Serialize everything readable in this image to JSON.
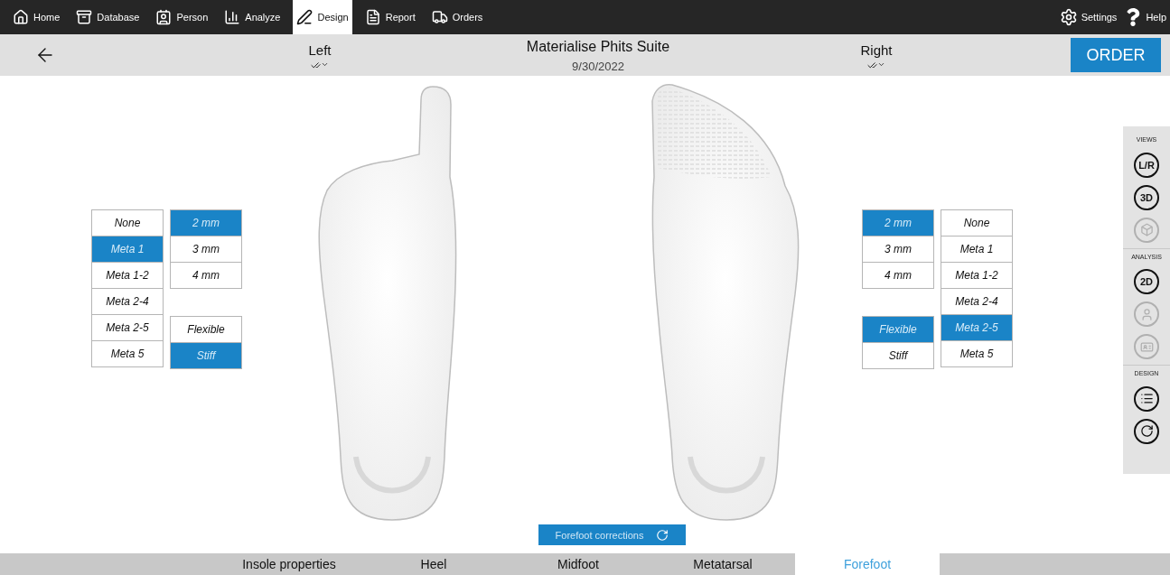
{
  "nav": {
    "items": [
      {
        "kind": "home",
        "label": "Home",
        "selected": false
      },
      {
        "kind": "database",
        "label": "Database",
        "selected": false
      },
      {
        "kind": "person",
        "label": "Person",
        "selected": false
      },
      {
        "kind": "analyze",
        "label": "Analyze",
        "selected": false
      },
      {
        "kind": "design",
        "label": "Design",
        "selected": true
      },
      {
        "kind": "report",
        "label": "Report",
        "selected": false
      },
      {
        "kind": "orders",
        "label": "Orders",
        "selected": false
      }
    ],
    "right": [
      {
        "kind": "settings",
        "label": "Settings"
      },
      {
        "kind": "help",
        "label": "Help"
      }
    ]
  },
  "header": {
    "left_label": "Left",
    "title": "Materialise Phits Suite",
    "date": "9/30/2022",
    "right_label": "Right",
    "order_button": "ORDER"
  },
  "left_options": {
    "meta": [
      {
        "label": "None",
        "selected": false
      },
      {
        "label": "Meta 1",
        "selected": true
      },
      {
        "label": "Meta 1-2",
        "selected": false
      },
      {
        "label": "Meta 2-4",
        "selected": false
      },
      {
        "label": "Meta 2-5",
        "selected": false
      },
      {
        "label": "Meta 5",
        "selected": false
      }
    ],
    "thickness": [
      {
        "label": "2 mm",
        "selected": true
      },
      {
        "label": "3 mm",
        "selected": false
      },
      {
        "label": "4 mm",
        "selected": false
      }
    ],
    "stiffness": [
      {
        "label": "Flexible",
        "selected": false
      },
      {
        "label": "Stiff",
        "selected": true
      }
    ]
  },
  "right_options": {
    "meta": [
      {
        "label": "None",
        "selected": false
      },
      {
        "label": "Meta 1",
        "selected": false
      },
      {
        "label": "Meta 1-2",
        "selected": false
      },
      {
        "label": "Meta 2-4",
        "selected": false
      },
      {
        "label": "Meta 2-5",
        "selected": true
      },
      {
        "label": "Meta 5",
        "selected": false
      }
    ],
    "thickness": [
      {
        "label": "2 mm",
        "selected": true
      },
      {
        "label": "3 mm",
        "selected": false
      },
      {
        "label": "4 mm",
        "selected": false
      }
    ],
    "stiffness": [
      {
        "label": "Flexible",
        "selected": true
      },
      {
        "label": "Stiff",
        "selected": false
      }
    ]
  },
  "side_panel": [
    {
      "title": "VIEWS",
      "buttons": [
        {
          "kind": "text",
          "label": "L/R",
          "disabled": false
        },
        {
          "kind": "text",
          "label": "3D",
          "disabled": false
        },
        {
          "kind": "cube",
          "disabled": true
        }
      ]
    },
    {
      "title": "ANALYSIS",
      "buttons": [
        {
          "kind": "text",
          "label": "2D",
          "disabled": false
        },
        {
          "kind": "person",
          "disabled": true
        },
        {
          "kind": "card",
          "disabled": true
        }
      ]
    },
    {
      "title": "DESIGN",
      "buttons": [
        {
          "kind": "list",
          "disabled": false
        },
        {
          "kind": "reset",
          "disabled": false
        }
      ]
    }
  ],
  "corrections_bar": {
    "label": "Forefoot corrections"
  },
  "bottom_tabs": [
    {
      "label": "Insole properties",
      "selected": false
    },
    {
      "label": "Heel",
      "selected": false
    },
    {
      "label": "Midfoot",
      "selected": false
    },
    {
      "label": "Metatarsal",
      "selected": false
    },
    {
      "label": "Forefoot",
      "selected": true
    }
  ]
}
